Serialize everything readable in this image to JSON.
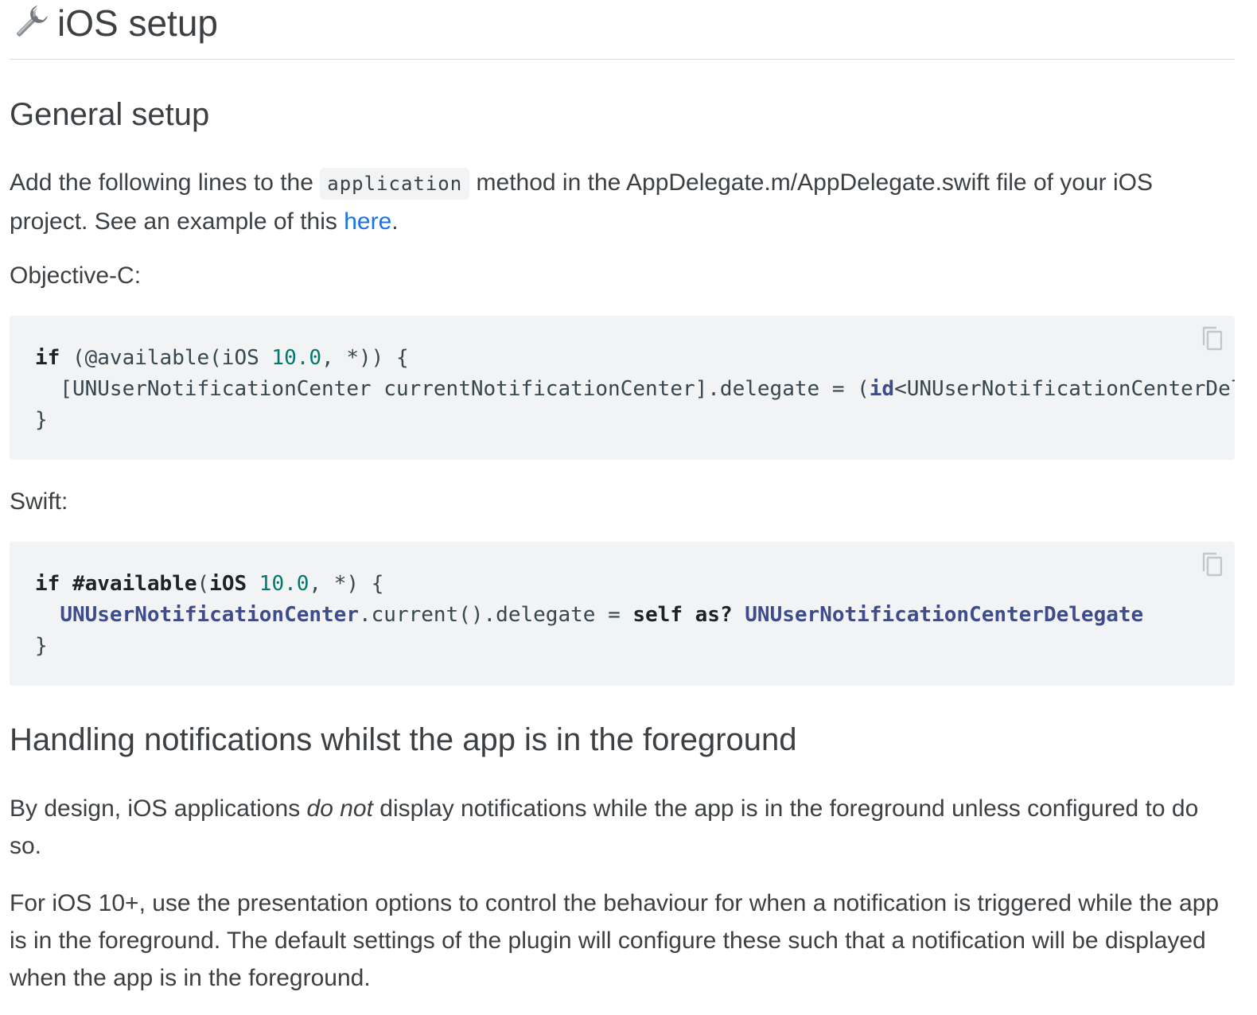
{
  "title": "iOS setup",
  "sections": {
    "general": {
      "heading": "General setup",
      "intro_before": "Add the following lines to the ",
      "intro_code": "application",
      "intro_after": " method in the AppDelegate.m/AppDelegate.swift file of your iOS project. See an example of this ",
      "intro_link": "here",
      "intro_end": ".",
      "objc_label": "Objective-C:",
      "swift_label": "Swift:"
    },
    "foreground": {
      "heading": "Handling notifications whilst the app is in the foreground",
      "p1_before": "By design, iOS applications ",
      "p1_em": "do not",
      "p1_after": " display notifications while the app is in the foreground unless configured to do so.",
      "p2": "For iOS 10+, use the presentation options to control the behaviour for when a notification is triggered while the app is in the foreground. The default settings of the plugin will configure these such that a notification will be displayed when the app is in the foreground."
    }
  },
  "code": {
    "objc": {
      "l1_kw": "if",
      "l1_a": " (@available(iOS ",
      "l1_num": "10.0",
      "l1_b": ", *)) {",
      "l2_a": "  [UNUserNotificationCenter currentNotificationCenter].delegate = (",
      "l2_kw": "id",
      "l2_b": "<UNUserNotificationCenterDelegate>) self;",
      "l3": "}"
    },
    "swift": {
      "l1_kw": "if",
      "l1_sp": " ",
      "l1_kw2": "#available",
      "l1_a": "(",
      "l1_kw3": "iOS",
      "l1_sp2": " ",
      "l1_num": "10.0",
      "l1_b": ", *) {",
      "l2_indent": "  ",
      "l2_type": "UNUserNotificationCenter",
      "l2_a": ".current().delegate = ",
      "l2_kw": "self",
      "l2_sp": " ",
      "l2_kw2": "as?",
      "l2_sp2": " ",
      "l2_type2": "UNUserNotificationCenterDelegate",
      "l3": "}"
    }
  },
  "icons": {
    "heading_icon": "wrench-icon",
    "copy_icon": "copy-icon"
  },
  "colors": {
    "link": "#1a73e8",
    "code_bg": "#f1f3f4",
    "number": "#00796b",
    "type": "#3f4c8c"
  }
}
